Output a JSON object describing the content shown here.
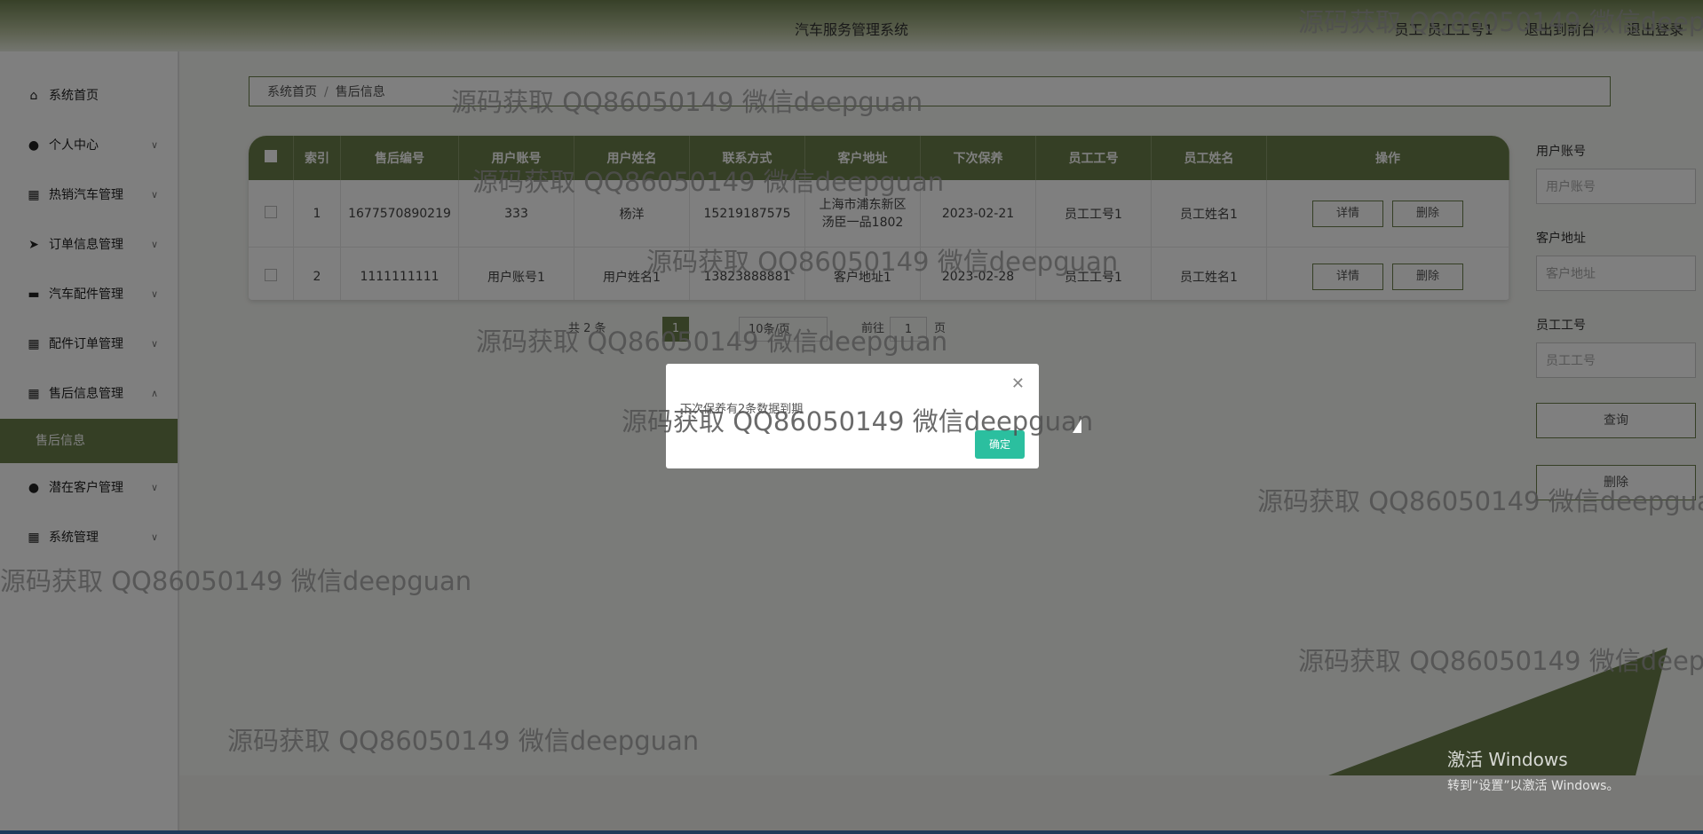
{
  "header": {
    "title": "汽车服务管理系统",
    "user_label": "员工 员工工号1",
    "front_link": "退出到前台",
    "logout_link": "退出登录"
  },
  "sidebar": {
    "items": [
      {
        "label": "系统首页",
        "icon": "home-icon"
      },
      {
        "label": "个人中心",
        "icon": "user-icon"
      },
      {
        "label": "热销汽车管理",
        "icon": "grid-icon"
      },
      {
        "label": "订单信息管理",
        "icon": "send-icon"
      },
      {
        "label": "汽车配件管理",
        "icon": "chat-icon"
      },
      {
        "label": "配件订单管理",
        "icon": "grid-icon"
      },
      {
        "label": "售后信息管理",
        "icon": "grid-icon"
      },
      {
        "label": "潜在客户管理",
        "icon": "user-icon"
      },
      {
        "label": "系统管理",
        "icon": "grid-icon"
      }
    ],
    "active_sub": "售后信息"
  },
  "breadcrumb": {
    "home": "系统首页",
    "separator": "/",
    "current": "售后信息"
  },
  "table": {
    "headers": [
      "索引",
      "售后编号",
      "用户账号",
      "用户姓名",
      "联系方式",
      "客户地址",
      "下次保养",
      "员工工号",
      "员工姓名",
      "操作"
    ],
    "rows": [
      {
        "index": "1",
        "code": "1677570890219",
        "account": "333",
        "name": "杨洋",
        "phone": "15219187575",
        "address": "上海市浦东新区汤臣一品1802",
        "next": "2023-02-21",
        "emp_no": "员工工号1",
        "emp_name": "员工姓名1"
      },
      {
        "index": "2",
        "code": "1111111111",
        "account": "用户账号1",
        "name": "用户姓名1",
        "phone": "13823888881",
        "address": "客户地址1",
        "next": "2023-02-28",
        "emp_no": "员工工号1",
        "emp_name": "员工姓名1"
      }
    ],
    "detail_label": "详情",
    "delete_label": "删除"
  },
  "pager": {
    "total": "共 2 条",
    "current": "1",
    "size": "10条/页",
    "goto": "前往",
    "page_input": "1",
    "page_unit": "页"
  },
  "search": {
    "account_label": "用户账号",
    "account_placeholder": "用户账号",
    "address_label": "客户地址",
    "address_placeholder": "客户地址",
    "emp_label": "员工工号",
    "emp_placeholder": "员工工号",
    "query_label": "查询",
    "delete_label": "删除"
  },
  "modal": {
    "message": "下次保养有2条数据到期",
    "ok_label": "确定"
  },
  "watermark": "源码获取 QQ86050149 微信deepguan",
  "activation": {
    "line1": "激活 Windows",
    "line2": "转到“设置”以激活 Windows。"
  },
  "colors": {
    "accent": "#6b7f4b",
    "ok_button": "#2bbf9f"
  }
}
